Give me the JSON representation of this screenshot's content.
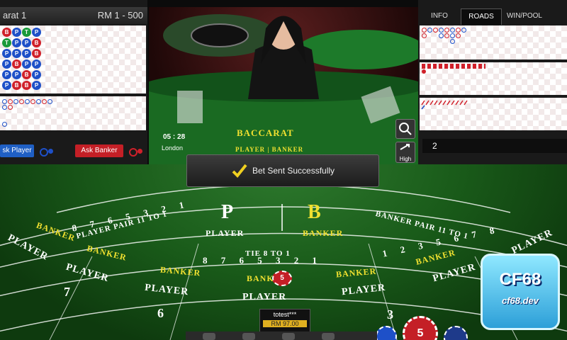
{
  "left_panel": {
    "title": "arat 1",
    "limit": "RM 1 - 500",
    "bead_road": [
      [
        "B",
        "P",
        "T",
        "P"
      ],
      [
        "T",
        "P",
        "P",
        "B"
      ],
      [
        "P",
        "P",
        "P",
        "B"
      ],
      [
        "P",
        "B",
        "P",
        "P"
      ],
      [
        "P",
        "P",
        "B",
        "P"
      ],
      [
        "P",
        "B",
        "B",
        "P"
      ]
    ],
    "ask_player": "sk Player",
    "ask_banker": "Ask Banker"
  },
  "video": {
    "time": "05 : 28",
    "city": "London",
    "game_name": "BACCARAT",
    "sub": "PLAYER | BANKER",
    "zoom_icon": "magnifier-icon",
    "quality": "High"
  },
  "right_panel": {
    "tabs": [
      "INFO",
      "ROADS",
      "WIN/POOL"
    ],
    "active_tab": "ROADS",
    "shoe_number": "2"
  },
  "toast": {
    "icon": "check-icon",
    "message": "Bet Sent Successfully"
  },
  "table": {
    "p_letter": "P",
    "p_label": "PLAYER",
    "b_letter": "B",
    "b_label": "BANKER",
    "player_pair": "PLAYER PAIR 11 TO 1",
    "banker_pair": "BANKER PAIR 11 TO 1",
    "tie": "TIE 8 TO 1",
    "left_numbers": [
      "8",
      "7",
      "6",
      "5",
      "3",
      "2",
      "1"
    ],
    "tie_numbers": [
      "8",
      "7",
      "6",
      "5",
      "3",
      "2",
      "1"
    ],
    "right_numbers": [
      "1",
      "2",
      "3",
      "5",
      "6",
      "7",
      "8"
    ],
    "seat_numbers": [
      "7",
      "6",
      "3"
    ],
    "banker_words": [
      "BANKER",
      "BANKER",
      "BANKER",
      "BANKER",
      "BANKER",
      "BANKER"
    ],
    "player_words": [
      "PLAYER",
      "PLAYER",
      "PLAYER",
      "PLAYER",
      "PLAYER",
      "PLAYER",
      "PLAYER"
    ],
    "placed_chip": "5",
    "user_name": "totest***",
    "balance": "RM 97.00",
    "chip_value": "5"
  },
  "watermark": {
    "brand": "CF68",
    "domain": "cf68.dev"
  },
  "colors": {
    "player": "#1e50c8",
    "banker": "#d0202a",
    "tie": "#1a9a3a",
    "felt": "#1f6a1f",
    "yellow": "#f0e030"
  }
}
